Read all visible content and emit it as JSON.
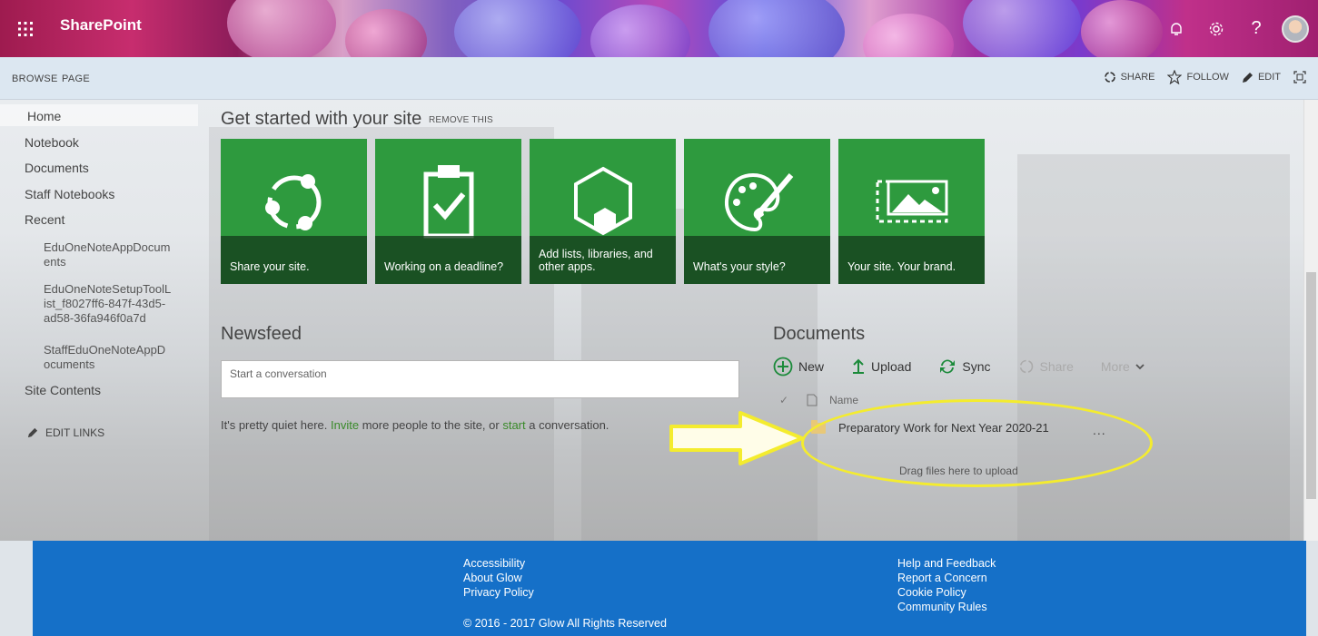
{
  "suite_bar": {
    "app_name": "SharePoint",
    "icons": [
      "waffle-icon",
      "bell-icon",
      "gear-icon",
      "help-icon",
      "avatar"
    ]
  },
  "ribbon": {
    "tabs": [
      "BROWSE",
      "PAGE"
    ],
    "actions": {
      "share": "SHARE",
      "follow": "FOLLOW",
      "edit": "EDIT"
    }
  },
  "leftnav": {
    "home": "Home",
    "notebook": "Notebook",
    "documents": "Documents",
    "staff_notebooks": "Staff Notebooks",
    "recent": "Recent",
    "recent_items": [
      [
        "EduOneNoteAppDocum",
        "ents"
      ],
      [
        "EduOneNoteSetupToolL",
        "ist_f8027ff6-847f-43d5-",
        "ad58-36fa946f0a7d"
      ],
      [
        "StaffEduOneNoteAppD",
        "ocuments"
      ]
    ],
    "site_contents": "Site Contents",
    "edit_links": "EDIT LINKS"
  },
  "get_started": {
    "title": "Get started with your site",
    "remove": "REMOVE THIS",
    "tiles": [
      {
        "caption": "Share your site.",
        "icon": "share-icon"
      },
      {
        "caption": "Working on a deadline?",
        "icon": "clipboard-check-icon"
      },
      {
        "caption": "Add lists, libraries, and other apps.",
        "icon": "apps-hexagon-icon"
      },
      {
        "caption": "What's your style?",
        "icon": "palette-icon"
      },
      {
        "caption": "Your site. Your brand.",
        "icon": "brand-image-icon"
      }
    ]
  },
  "newsfeed": {
    "title": "Newsfeed",
    "placeholder": "Start a conversation",
    "quiet_pre": "It's pretty quiet here. ",
    "invite": "Invite",
    "quiet_mid": " more people to the site, or ",
    "start": "start",
    "quiet_post": " a conversation."
  },
  "documents": {
    "title": "Documents",
    "commands": {
      "new": "New",
      "upload": "Upload",
      "sync": "Sync",
      "share": "Share",
      "more": "More"
    },
    "column_name": "Name",
    "items": [
      {
        "name": "Preparatory Work for Next Year 2020-21",
        "type": "folder"
      }
    ],
    "ellipsis": "...",
    "drag_text": "Drag files here to upload"
  },
  "footer": {
    "left_links": [
      "Accessibility",
      "About Glow",
      "Privacy Policy"
    ],
    "right_links": [
      "Help and Feedback",
      "Report a Concern",
      "Cookie Policy",
      "Community Rules"
    ],
    "copyright": "© 2016 - 2017 Glow All Rights Reserved"
  },
  "colors": {
    "tile_green": "#2e9a3e",
    "footer_blue": "#1570c8",
    "annotation_yellow": "#f4ec2e",
    "link_green": "#3a8a2a"
  }
}
